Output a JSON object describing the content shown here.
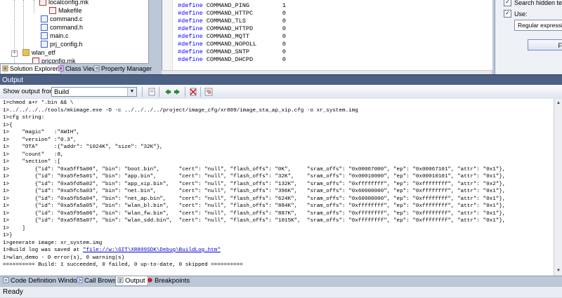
{
  "solution_tree": {
    "items": [
      {
        "label": "localconfig.mk"
      },
      {
        "label": "Makefile"
      },
      {
        "label": "command.c"
      },
      {
        "label": "command.h"
      },
      {
        "label": "main.c"
      },
      {
        "label": "prj_config.h"
      },
      {
        "label": "wlan_etf"
      },
      {
        "label": "prjconfig.mk"
      }
    ]
  },
  "left_tabs": {
    "solution_explorer": "Solution Explorer",
    "class_view": "Class View",
    "property_manager": "Property Manager"
  },
  "code_editor": {
    "lines": [
      {
        "kw": "#define",
        "name": "COMMAND_PING",
        "value": "1"
      },
      {
        "kw": "#define",
        "name": "COMMAND_HTTPC",
        "value": "0"
      },
      {
        "kw": "#define",
        "name": "COMMAND_TLS",
        "value": "0"
      },
      {
        "kw": "#define",
        "name": "COMMAND_HTTPD",
        "value": "0"
      },
      {
        "kw": "#define",
        "name": "COMMAND_MQTT",
        "value": "0"
      },
      {
        "kw": "#define",
        "name": "COMMAND_NOPOLL",
        "value": "0"
      },
      {
        "kw": "#define",
        "name": "COMMAND_SNTP",
        "value": "0"
      },
      {
        "kw": "#define",
        "name": "COMMAND_DHCPD",
        "value": "0"
      }
    ]
  },
  "find_panel": {
    "search_hidden_text": "Search hidden text",
    "use_label": "Use:",
    "regex_option": "Regular expressions",
    "find_button": "Find"
  },
  "output": {
    "title": "Output",
    "show_output_from_label": "Show output from:",
    "source_selected": "Build",
    "lines": [
      "1>chmod a+r *.bin && \\",
      "1>../../../../tools/mkimage.exe -O -c ../../../../project/image_cfg/xr809/image_sta_ap_xip.cfg -o xr_system.img",
      "1>cfg string:",
      "1>{",
      "1>    \"magic\"   :\"AWIH\",",
      "1>    \"version\" :\"0.3\",",
      "1>    \"OTA\"     :{\"addr\": \"1024K\", \"size\": \"32K\"},",
      "1>    \"count\"   :8,",
      "1>    \"section\" :[",
      "1>        {\"id\": \"0xa5ff5a00\", \"bin\": \"boot.bin\",      \"cert\": \"null\", \"flash_offs\": \"0K\",     \"sram_offs\": \"0x00067000\", \"ep\": \"0x00067101\", \"attr\": \"0x1\"},",
      "1>        {\"id\": \"0xa5fe5a01\", \"bin\": \"app.bin\",       \"cert\": \"null\", \"flash_offs\": \"32K\",    \"sram_offs\": \"0x00010000\", \"ep\": \"0x00010101\", \"attr\": \"0x1\"},",
      "1>        {\"id\": \"0xa5fd5a02\", \"bin\": \"app_xip.bin\",   \"cert\": \"null\", \"flash_offs\": \"132K\",   \"sram_offs\": \"0xffffffff\", \"ep\": \"0xffffffff\", \"attr\": \"0x2\"},",
      "1>        {\"id\": \"0xa5fc5a03\", \"bin\": \"net.bin\",       \"cert\": \"null\", \"flash_offs\": \"396K\",   \"sram_offs\": \"0x60000000\", \"ep\": \"0xffffffff\", \"attr\": \"0x1\"},",
      "1>        {\"id\": \"0xa5fb5a04\", \"bin\": \"net_ap.bin\",    \"cert\": \"null\", \"flash_offs\": \"624K\",   \"sram_offs\": \"0x60000000\", \"ep\": \"0xffffffff\", \"attr\": \"0x1\"},",
      "1>        {\"id\": \"0xa5fa5a05\", \"bin\": \"wlan_bl.bin\",   \"cert\": \"null\", \"flash_offs\": \"884K\",   \"sram_offs\": \"0xffffffff\", \"ep\": \"0xffffffff\", \"attr\": \"0x1\"},",
      "1>        {\"id\": \"0xa5f95a06\", \"bin\": \"wlan_fw.bin\",   \"cert\": \"null\", \"flash_offs\": \"887K\",   \"sram_offs\": \"0xffffffff\", \"ep\": \"0xffffffff\", \"attr\": \"0x1\"},",
      "1>        {\"id\": \"0xa5f85a07\", \"bin\": \"wlan_sdd.bin\",  \"cert\": \"null\", \"flash_offs\": \"1015K\",  \"sram_offs\": \"0xffffffff\", \"ep\": \"0xffffffff\", \"attr\": \"0x1\"},",
      "1>    ]",
      "1>}",
      "1>generate image: xr_system.img"
    ],
    "build_log_prefix": "1>Build log was saved at ",
    "build_log_link": "\"file://w:\\GIT\\XR809SDK\\Debug\\BuildLog.htm\"",
    "tail_lines": [
      "1>wlan_demo - 0 error(s), 0 warning(s)",
      "========== Build: 1 succeeded, 0 failed, 0 up-to-date, 0 skipped =========="
    ]
  },
  "bottom_tabs": {
    "code_definition": "Code Definition Window",
    "call_browser": "Call Browser",
    "output": "Output",
    "breakpoints": "Breakpoints"
  },
  "status": {
    "text": "Ready"
  },
  "colors": {
    "title_bar": "#4d6185",
    "keyword": "#0000ff",
    "link": "#0000cc"
  }
}
